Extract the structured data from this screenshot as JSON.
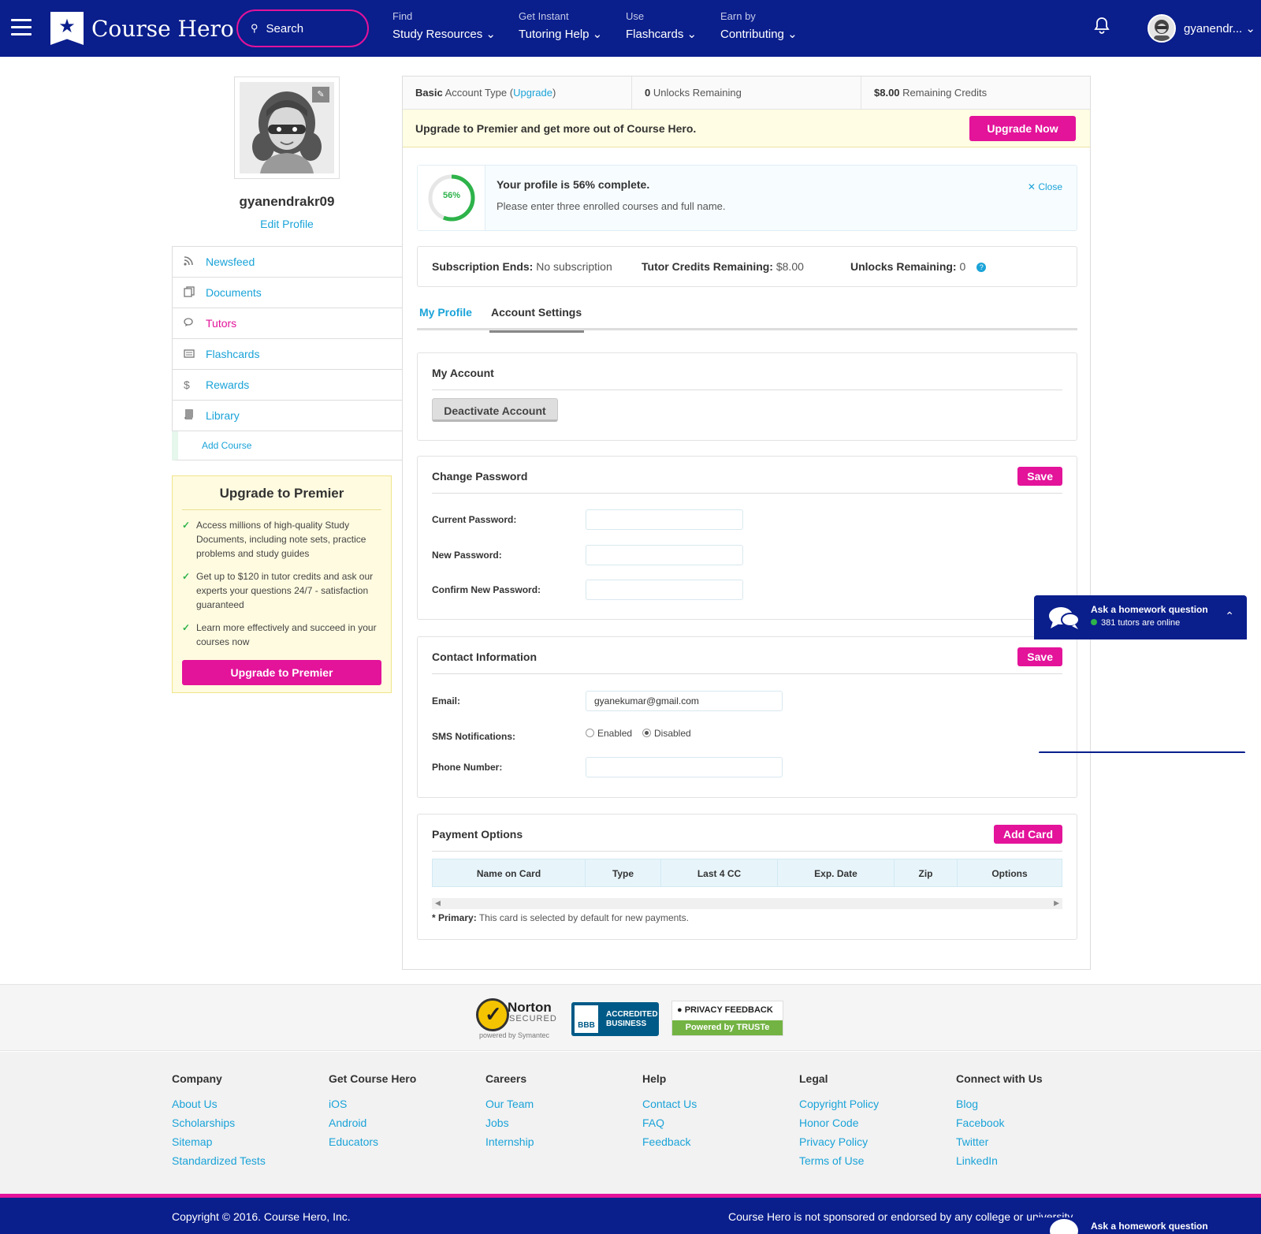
{
  "header": {
    "logo_text": "Course Hero",
    "search_label": "Search",
    "nav": [
      {
        "small": "Find",
        "big": "Study Resources"
      },
      {
        "small": "Get Instant",
        "big": "Tutoring Help"
      },
      {
        "small": "Use",
        "big": "Flashcards"
      },
      {
        "small": "Earn by",
        "big": "Contributing"
      }
    ],
    "user_name": "gyanendr...",
    "chevron": "⌄"
  },
  "profile": {
    "username": "gyanendrakr09",
    "edit_label": "Edit Profile"
  },
  "sidebar": {
    "items": [
      {
        "label": "Newsfeed",
        "icon": "rss-icon"
      },
      {
        "label": "Documents",
        "icon": "documents-icon"
      },
      {
        "label": "Tutors",
        "icon": "chat-icon"
      },
      {
        "label": "Flashcards",
        "icon": "flashcards-icon"
      },
      {
        "label": "Rewards",
        "icon": "dollar-icon"
      },
      {
        "label": "Library",
        "icon": "book-icon"
      }
    ],
    "add_course": "Add Course"
  },
  "upgrade_box": {
    "title": "Upgrade to Premier",
    "bullets": [
      "Access millions of high-quality Study Documents, including note sets, practice problems and study guides",
      "Get up to $120 in tutor credits and ask our experts your questions 24/7 - satisfaction guaranteed",
      "Learn more effectively and succeed in your courses now"
    ],
    "button": "Upgrade to Premier"
  },
  "account_bar": {
    "type_bold": "Basic",
    "type_text": "Account Type (",
    "upgrade_link": "Upgrade",
    "type_close": ")",
    "unlocks_bold": "0",
    "unlocks_text": "Unlocks Remaining",
    "credits_bold": "$8.00",
    "credits_text": "Remaining Credits"
  },
  "promo": {
    "text": "Upgrade to Premier and get more out of Course Hero.",
    "button": "Upgrade Now"
  },
  "progress": {
    "percent": 56,
    "percent_label": "56%",
    "title": "Your profile is 56% complete.",
    "subtitle": "Please enter three enrolled courses and full name.",
    "close": "Close"
  },
  "subscription": {
    "ends_label": "Subscription Ends:",
    "ends_value": "No subscription",
    "tutor_label": "Tutor Credits Remaining:",
    "tutor_value": "$8.00",
    "unlocks_label": "Unlocks Remaining:",
    "unlocks_value": "0",
    "help": "?"
  },
  "tabs": {
    "my_profile": "My Profile",
    "account_settings": "Account Settings"
  },
  "my_account": {
    "title": "My Account",
    "deactivate": "Deactivate Account"
  },
  "change_password": {
    "title": "Change Password",
    "save": "Save",
    "current": "Current Password:",
    "new": "New Password:",
    "confirm": "Confirm New Password:"
  },
  "contact": {
    "title": "Contact Information",
    "save": "Save",
    "email_label": "Email:",
    "email_value": "gyanekumar@gmail.com",
    "sms_label": "SMS Notifications:",
    "enabled": "Enabled",
    "disabled": "Disabled",
    "phone_label": "Phone Number:"
  },
  "payment": {
    "title": "Payment Options",
    "add_card": "Add Card",
    "columns": [
      "Name on Card",
      "Type",
      "Last 4 CC",
      "Exp. Date",
      "Zip",
      "Options"
    ],
    "note_bold": "* Primary:",
    "note_text": "This card is selected by default for new payments."
  },
  "chat": {
    "title": "Ask a homework question",
    "online": "381 tutors are online"
  },
  "badges": {
    "norton_name": "Norton",
    "norton_secured": "SECURED",
    "norton_powered": "powered by Symantec",
    "bbb_logo": "BBB",
    "bbb_line1": "ACCREDITED",
    "bbb_line2": "BUSINESS",
    "truste_top": "PRIVACY FEEDBACK",
    "truste_bottom": "Powered by TRUSTe"
  },
  "footer": {
    "columns": [
      {
        "title": "Company",
        "links": [
          "About Us",
          "Scholarships",
          "Sitemap",
          "Standardized Tests"
        ]
      },
      {
        "title": "Get Course Hero",
        "links": [
          "iOS",
          "Android",
          "Educators"
        ]
      },
      {
        "title": "Careers",
        "links": [
          "Our Team",
          "Jobs",
          "Internship"
        ]
      },
      {
        "title": "Help",
        "links": [
          "Contact Us",
          "FAQ",
          "Feedback"
        ]
      },
      {
        "title": "Legal",
        "links": [
          "Copyright Policy",
          "Honor Code",
          "Privacy Policy",
          "Terms of Use"
        ]
      },
      {
        "title": "Connect with Us",
        "links": [
          "Blog",
          "Facebook",
          "Twitter",
          "LinkedIn"
        ]
      }
    ],
    "copyright": "Copyright © 2016. Course Hero, Inc.",
    "disclaimer": "Course Hero is not sponsored or endorsed by any college or university."
  },
  "colors": {
    "navy": "#0a1e8c",
    "pink": "#e3139a",
    "link": "#1aa3d8",
    "green": "#2db34a"
  }
}
